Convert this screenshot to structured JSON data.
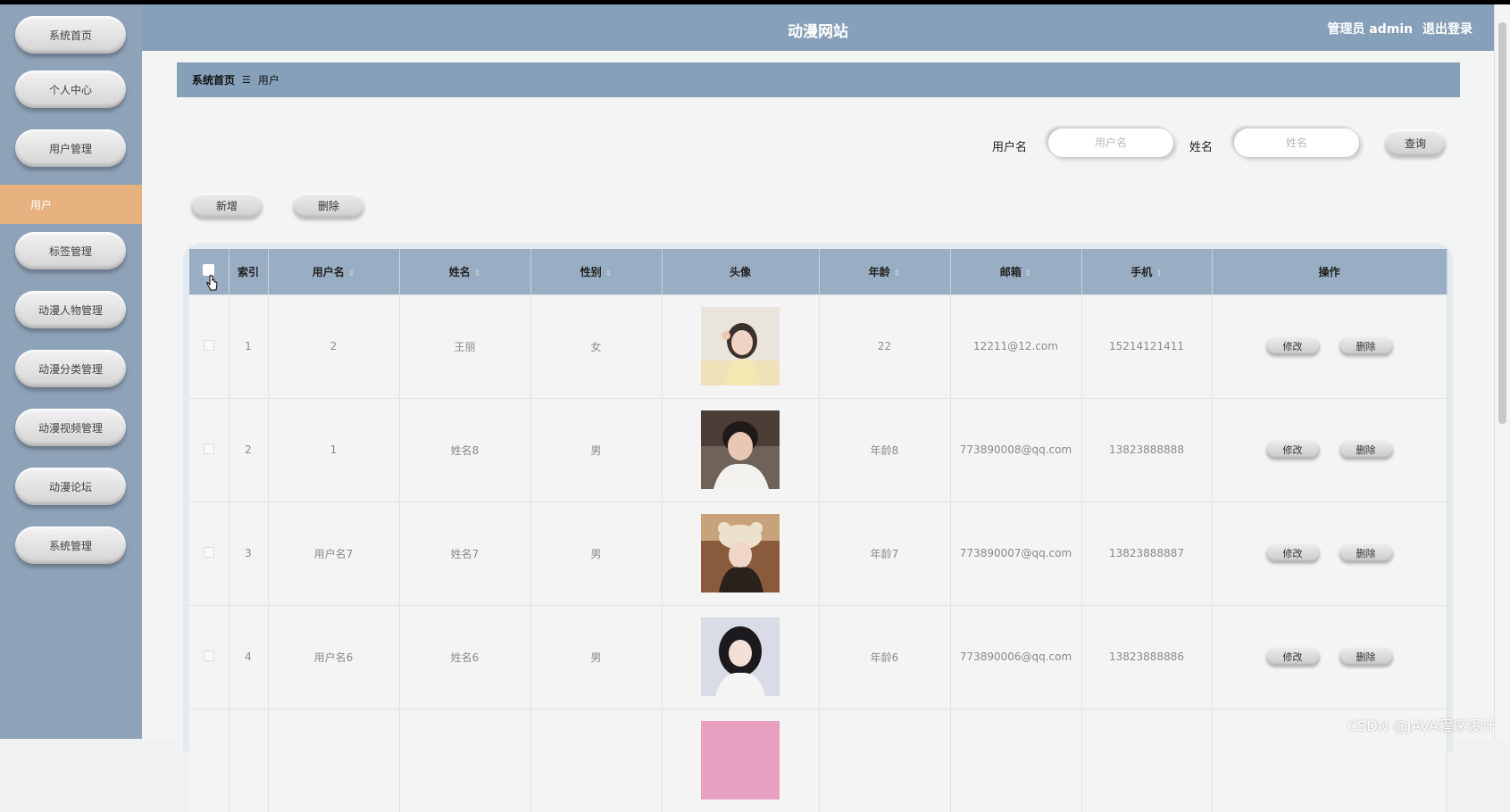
{
  "header": {
    "site_title": "动漫网站",
    "user_label": "管理员 admin",
    "logout": "退出登录"
  },
  "sidebar": {
    "items": [
      {
        "label": "系统首页"
      },
      {
        "label": "个人中心"
      },
      {
        "label": "用户管理"
      },
      {
        "label": "标签管理"
      },
      {
        "label": "动漫人物管理"
      },
      {
        "label": "动漫分类管理"
      },
      {
        "label": "动漫视频管理"
      },
      {
        "label": "动漫论坛"
      },
      {
        "label": "系统管理"
      }
    ],
    "active_item": "用户"
  },
  "breadcrumb": {
    "home": "系统首页",
    "separator": "☰",
    "current": "用户"
  },
  "search": {
    "username_label": "用户名",
    "username_placeholder": "用户名",
    "name_label": "姓名",
    "name_placeholder": "姓名",
    "query_button": "查询"
  },
  "actions": {
    "add": "新增",
    "delete": "删除"
  },
  "table": {
    "headers": [
      "索引",
      "用户名",
      "姓名",
      "性别",
      "头像",
      "年龄",
      "邮箱",
      "手机",
      "操作"
    ],
    "rows": [
      {
        "index": "1",
        "username": "2",
        "name": "王丽",
        "gender": "女",
        "age": "22",
        "email": "12211@12.com",
        "phone": "15214121411",
        "edit": "修改",
        "delete": "删除"
      },
      {
        "index": "2",
        "username": "1",
        "name": "姓名8",
        "gender": "男",
        "age": "年龄8",
        "email": "773890008@qq.com",
        "phone": "13823888888",
        "edit": "修改",
        "delete": "删除"
      },
      {
        "index": "3",
        "username": "用户名7",
        "name": "姓名7",
        "gender": "男",
        "age": "年龄7",
        "email": "773890007@qq.com",
        "phone": "13823888887",
        "edit": "修改",
        "delete": "删除"
      },
      {
        "index": "4",
        "username": "用户名6",
        "name": "姓名6",
        "gender": "男",
        "age": "年龄6",
        "email": "773890006@qq.com",
        "phone": "13823888886",
        "edit": "修改",
        "delete": "删除"
      }
    ]
  },
  "watermark": "CSDN @JAVA程序设计",
  "colors": {
    "sidebar_bg": "#8ea2b8",
    "header_bg": "#87a0b9",
    "active_nav": "#e7b27f",
    "table_head": "#99aec2"
  }
}
